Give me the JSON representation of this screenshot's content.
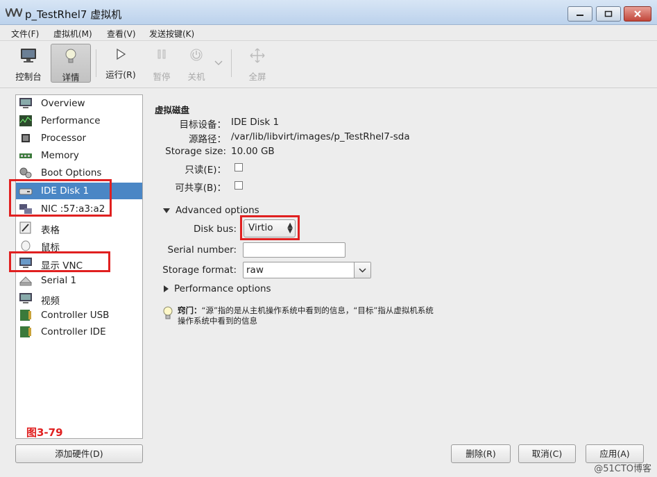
{
  "window": {
    "title": "p_TestRhel7 虚拟机"
  },
  "menu": [
    "文件(F)",
    "虚拟机(M)",
    "查看(V)",
    "发送按键(K)"
  ],
  "toolbar": {
    "console": "控制台",
    "details": "详情",
    "run": "运行(R)",
    "pause": "暂停",
    "shutdown": "关机",
    "fullscreen": "全屏"
  },
  "sidebar": {
    "items": [
      {
        "label": "Overview",
        "icon": "monitor-icon"
      },
      {
        "label": "Performance",
        "icon": "performance-icon"
      },
      {
        "label": "Processor",
        "icon": "cpu-icon"
      },
      {
        "label": "Memory",
        "icon": "memory-icon"
      },
      {
        "label": "Boot Options",
        "icon": "gears-icon"
      },
      {
        "label": "IDE Disk 1",
        "icon": "disk-icon"
      },
      {
        "label": "NIC :57:a3:a2",
        "icon": "network-icon"
      },
      {
        "label": "表格",
        "icon": "tablet-icon"
      },
      {
        "label": "鼠标",
        "icon": "mouse-icon"
      },
      {
        "label": "显示 VNC",
        "icon": "display-icon"
      },
      {
        "label": "Serial 1",
        "icon": "serial-icon"
      },
      {
        "label": "视频",
        "icon": "video-icon"
      },
      {
        "label": "Controller USB",
        "icon": "controller-icon"
      },
      {
        "label": "Controller IDE",
        "icon": "controller-icon"
      }
    ],
    "selected_index": 5,
    "figure_label": "图3-79",
    "add_hardware": "添加硬件(D)"
  },
  "details": {
    "section_title": "虚拟磁盘",
    "target_device_label": "目标设备：",
    "target_device": "IDE Disk 1",
    "source_path_label": "源路径：",
    "source_path": "/var/lib/libvirt/images/p_TestRhel7-sda",
    "storage_size_label": "Storage size:",
    "storage_size": "10.00 GB",
    "readonly_label": "只读(E)：",
    "shareable_label": "可共享(B)：",
    "advanced_options": "Advanced options",
    "disk_bus_label": "Disk bus:",
    "disk_bus": "Virtio",
    "serial_number_label": "Serial number:",
    "serial_number": "",
    "storage_format_label": "Storage format:",
    "storage_format": "raw",
    "performance_options": "Performance options",
    "tip_prefix": "窍门：",
    "tip_body": "“源”指的是从主机操作系统中看到的信息，“目标”指从虚拟机系统操作系统中看到的信息"
  },
  "buttons": {
    "remove": "删除(R)",
    "cancel": "取消(C)",
    "apply": "应用(A)"
  },
  "watermark": "@51CTO博客",
  "colors": {
    "selection": "#4a86c5",
    "highlight": "#e02020"
  }
}
